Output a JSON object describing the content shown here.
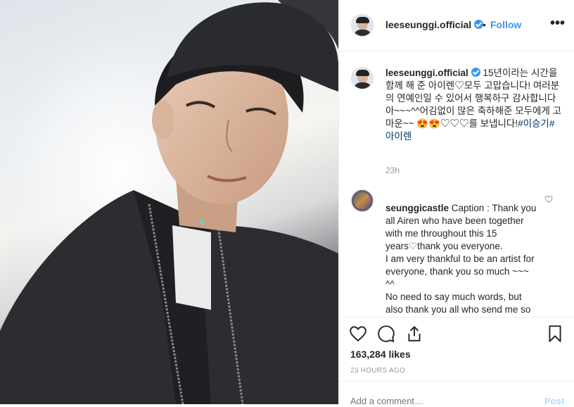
{
  "header": {
    "username": "leeseunggi.official",
    "separator": "•",
    "follow_label": "Follow",
    "more_label": "•••"
  },
  "caption": {
    "username": "leeseunggi.official",
    "text": " 15년이라는 시간을 함께 해 준 아이렌♡모두 고맙습니다! 여러분의 연예인일 수 있어서 행복하구 감사합니다아~~~^^어김없이 많은 축하해준 모두에게 고마운~~ 😍😍♡♡♡를 보냅니다!",
    "hashtag": "#이승기#아이렌",
    "time": "23h"
  },
  "comments": [
    {
      "username": "seunggicastle",
      "text": " Caption : Thank you all Airen who have been together with me throughout this 15 years♡thank you everyone.\nI am very thankful to be an artist for everyone, thank you so much ~~~ ^^\nNo need to say much words, but also thank you all who send me so much blessings ~~~😍😍♡"
    }
  ],
  "actions": {
    "icons": [
      "heart-icon",
      "comment-icon",
      "share-icon",
      "bookmark-icon"
    ],
    "likes": "163,284 likes",
    "posted_ago": "23 HOURS AGO"
  },
  "add_comment": {
    "placeholder": "Add a comment…",
    "post_label": "Post"
  },
  "colors": {
    "link_blue": "#3897f0",
    "hashtag": "#003569",
    "muted": "#999999",
    "post_disabled": "#b2dffc"
  }
}
